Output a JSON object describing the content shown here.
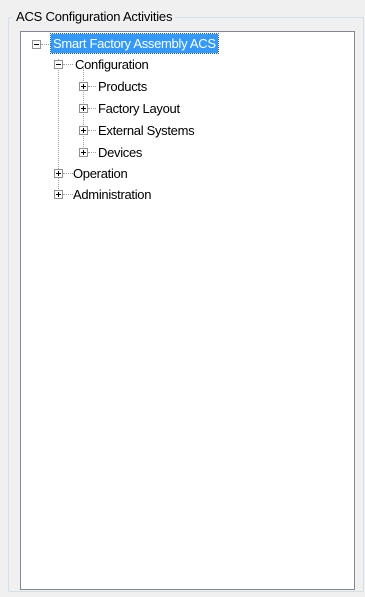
{
  "group": {
    "title": "ACS Configuration Activities"
  },
  "tree": {
    "root": {
      "label": "Smart Factory Assembly ACS",
      "expanded": true,
      "selected": true
    },
    "configuration": {
      "label": "Configuration",
      "expanded": true
    },
    "products": {
      "label": "Products",
      "expanded": false
    },
    "factory_layout": {
      "label": "Factory Layout",
      "expanded": false
    },
    "external_systems": {
      "label": "External Systems",
      "expanded": false
    },
    "devices": {
      "label": "Devices",
      "expanded": false
    },
    "operation": {
      "label": "Operation",
      "expanded": false
    },
    "administration": {
      "label": "Administration",
      "expanded": false
    }
  }
}
